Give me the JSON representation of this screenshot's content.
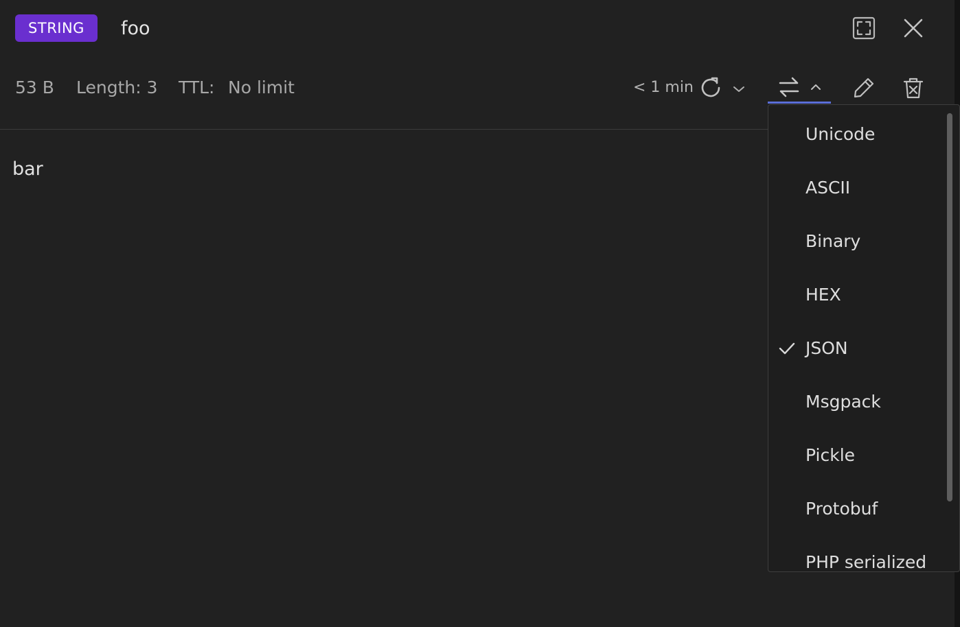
{
  "header": {
    "type_badge": "STRING",
    "key_name": "foo"
  },
  "meta": {
    "size": "53 B",
    "length": "Length: 3",
    "ttl_label": "TTL:",
    "ttl_value": "No limit",
    "refresh_time": "< 1 min"
  },
  "value": {
    "text": "bar"
  },
  "format_menu": {
    "items": [
      {
        "label": "Unicode"
      },
      {
        "label": "ASCII"
      },
      {
        "label": "Binary"
      },
      {
        "label": "HEX"
      },
      {
        "label": "JSON"
      },
      {
        "label": "Msgpack"
      },
      {
        "label": "Pickle"
      },
      {
        "label": "Protobuf"
      },
      {
        "label": "PHP serialized"
      }
    ],
    "selected": "JSON"
  },
  "colors": {
    "background": "#212121",
    "badge": "#6a2fcf",
    "accent": "#5a6ed8"
  },
  "icons": {
    "fullscreen": "fullscreen-icon",
    "close": "close-icon",
    "refresh": "refresh-icon",
    "chevron_down": "chevron-down-icon",
    "format": "swap-arrows-icon",
    "chevron_up": "chevron-up-icon",
    "edit": "pencil-icon",
    "delete": "trash-icon",
    "check": "check-icon"
  }
}
